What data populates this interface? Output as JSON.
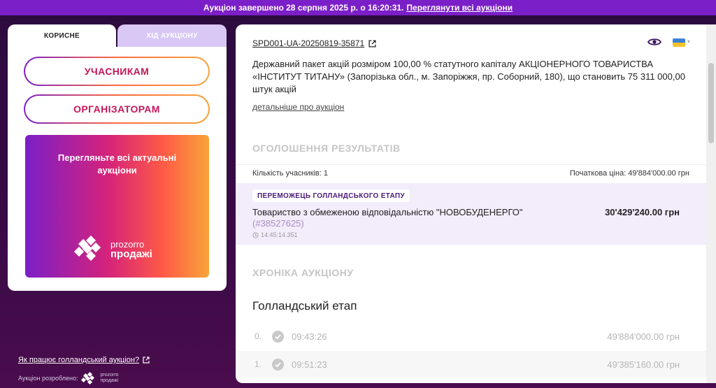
{
  "topbar": {
    "message": "Аукціон завершено 28 серпня 2025 р. о 16:20:31.",
    "link": "Переглянути всі аукціони"
  },
  "left": {
    "tabs": [
      {
        "label": "КОРИСНЕ",
        "active": true
      },
      {
        "label": "ХІД АУКЦІОНУ",
        "active": false
      }
    ],
    "buttons": {
      "participants": "УЧАСНИКАМ",
      "organizers": "ОРГАНІЗАТОРАМ"
    },
    "promo": {
      "text": "Перегляньте всі актуальні аукціони",
      "logo_line1": "prozorro",
      "logo_line2": "продажі"
    },
    "how_link": "Як працює голландський аукціон?",
    "developed_by": "Аукціон розроблено:",
    "dev_logo_line1": "prozorro",
    "dev_logo_line2": "продажі"
  },
  "auction": {
    "id": "SPD001-UA-20250819-35871",
    "description": "Державний пакет акцій розміром 100,00 % статутного капіталу АКЦІОНЕРНОГО ТОВАРИСТВА «ІНСТИТУТ ТИТАНУ» (Запорізька обл., м. Запоріжжя, пр. Соборний, 180), що становить 75 311 000,00 штук акцій",
    "more_link": "детальніше про аукціон"
  },
  "results": {
    "title": "ОГОЛОШЕННЯ РЕЗУЛЬТАТІВ",
    "participants_count": "Кількість учасників: 1",
    "start_price": "Початкова ціна: 49'884'000.00 грн",
    "winner": {
      "badge": "ПЕРЕМОЖЕЦЬ ГОЛЛАНДСЬКОГО ЕТАПУ",
      "name": "Товариство з обмеженою відповідальністю \"НОВОБУДЕНЕРГО\"",
      "id": "(#38527625)",
      "time": "14:45:14.351",
      "price": "30'429'240.00 грн"
    }
  },
  "chronicle": {
    "title": "ХРОНІКА АУКЦІОНУ",
    "stage": "Голландський етап",
    "rows": [
      {
        "index": "0.",
        "time": "09:43:26",
        "amount": "49'884'000.00 грн"
      },
      {
        "index": "1.",
        "time": "09:51:23",
        "amount": "49'385'160.00 грн"
      }
    ]
  },
  "colors": {
    "topbar": "#7b1fc8",
    "accent_text": "#c2185b",
    "winner_bg": "#f3ecfb"
  }
}
